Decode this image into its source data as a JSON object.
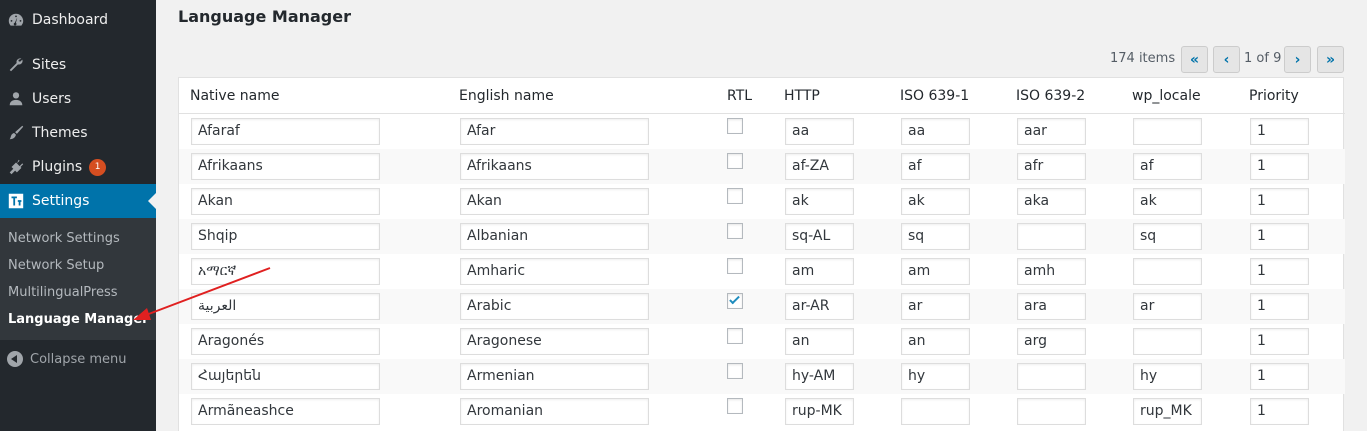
{
  "sidebar": {
    "items": [
      {
        "label": "Dashboard",
        "icon": "dashboard-icon"
      },
      {
        "label": "Sites",
        "icon": "wrench-icon"
      },
      {
        "label": "Users",
        "icon": "users-icon"
      },
      {
        "label": "Themes",
        "icon": "brush-icon"
      },
      {
        "label": "Plugins",
        "icon": "plugin-icon",
        "badge": "1"
      },
      {
        "label": "Settings",
        "icon": "settings-icon",
        "active": true
      }
    ],
    "submenu": [
      "Network Settings",
      "Network Setup",
      "MultilingualPress",
      "Language Manager"
    ],
    "collapse_label": "Collapse menu"
  },
  "page": {
    "title": "Language Manager",
    "item_count": "174 items",
    "page_indicator": "1 of 9",
    "pager": {
      "first": "«",
      "prev": "‹",
      "next": "›",
      "last": "»"
    }
  },
  "table": {
    "headers": [
      "Native name",
      "English name",
      "RTL",
      "HTTP",
      "ISO 639-1",
      "ISO 639-2",
      "wp_locale",
      "Priority"
    ],
    "rows": [
      {
        "native": "Afaraf",
        "english": "Afar",
        "rtl": false,
        "http": "aa",
        "iso1": "aa",
        "iso2": "aar",
        "locale": "",
        "priority": "1"
      },
      {
        "native": "Afrikaans",
        "english": "Afrikaans",
        "rtl": false,
        "http": "af-ZA",
        "iso1": "af",
        "iso2": "afr",
        "locale": "af",
        "priority": "1"
      },
      {
        "native": "Akan",
        "english": "Akan",
        "rtl": false,
        "http": "ak",
        "iso1": "ak",
        "iso2": "aka",
        "locale": "ak",
        "priority": "1"
      },
      {
        "native": "Shqip",
        "english": "Albanian",
        "rtl": false,
        "http": "sq-AL",
        "iso1": "sq",
        "iso2": "",
        "locale": "sq",
        "priority": "1"
      },
      {
        "native": "አማርኛ",
        "english": "Amharic",
        "rtl": false,
        "http": "am",
        "iso1": "am",
        "iso2": "amh",
        "locale": "",
        "priority": "1"
      },
      {
        "native": "العربية",
        "english": "Arabic",
        "rtl": true,
        "http": "ar-AR",
        "iso1": "ar",
        "iso2": "ara",
        "locale": "ar",
        "priority": "1"
      },
      {
        "native": "Aragonés",
        "english": "Aragonese",
        "rtl": false,
        "http": "an",
        "iso1": "an",
        "iso2": "arg",
        "locale": "",
        "priority": "1"
      },
      {
        "native": "Հայերեն",
        "english": "Armenian",
        "rtl": false,
        "http": "hy-AM",
        "iso1": "hy",
        "iso2": "",
        "locale": "hy",
        "priority": "1"
      },
      {
        "native": "Armãneashce",
        "english": "Aromanian",
        "rtl": false,
        "http": "rup-MK",
        "iso1": "",
        "iso2": "",
        "locale": "rup_MK",
        "priority": "1"
      }
    ]
  },
  "colors": {
    "accent": "#0073aa",
    "sidebar_bg": "#23282d",
    "annotation_arrow": "#e02020"
  }
}
